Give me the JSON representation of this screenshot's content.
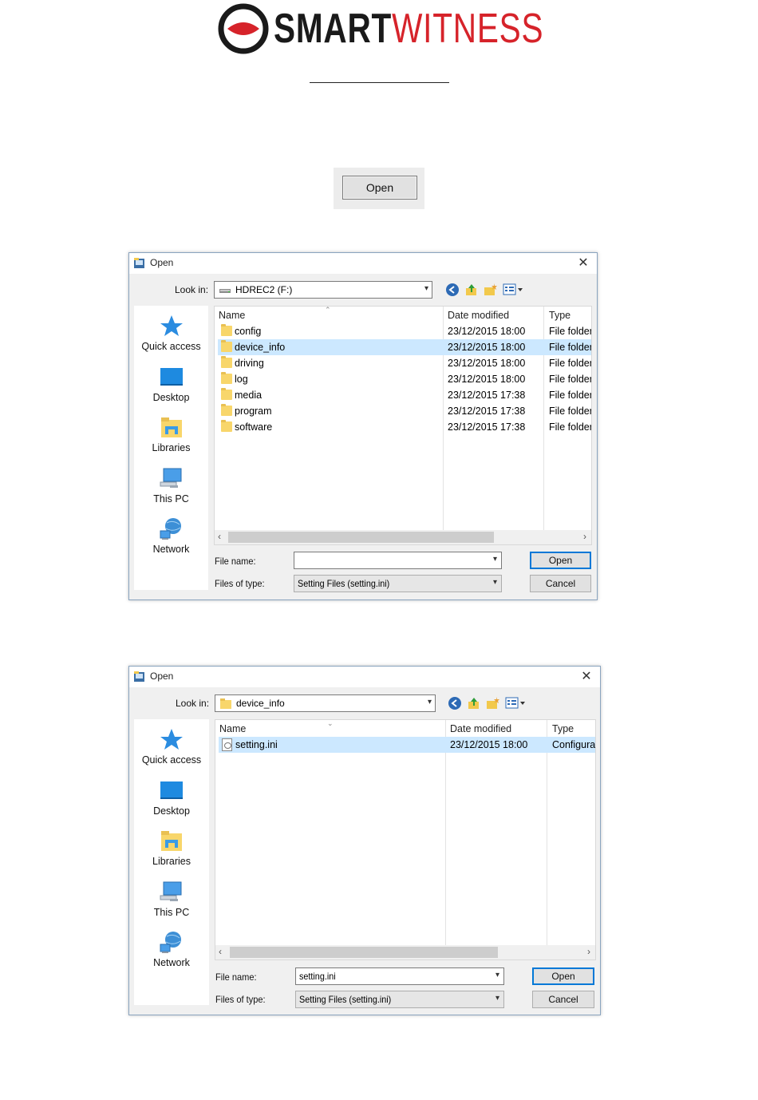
{
  "logo": {
    "smart": "SMART",
    "witness": "WITNESS",
    "brand_red": "#d6232a",
    "brand_dark": "#1a1a1a"
  },
  "open_button": {
    "label": "Open"
  },
  "dialog1": {
    "title": "Open",
    "look_in_label": "Look in:",
    "look_in_value": "HDREC2 (F:)",
    "look_in_icon": "drive-icon",
    "places": [
      {
        "label": "Quick access",
        "icon": "star-icon"
      },
      {
        "label": "Desktop",
        "icon": "desktop-icon"
      },
      {
        "label": "Libraries",
        "icon": "libraries-icon"
      },
      {
        "label": "This PC",
        "icon": "computer-icon"
      },
      {
        "label": "Network",
        "icon": "network-icon"
      }
    ],
    "columns": {
      "name": "Name",
      "date": "Date modified",
      "type": "Type"
    },
    "rows": [
      {
        "name": "config",
        "date": "23/12/2015 18:00",
        "type": "File folder",
        "selected": false
      },
      {
        "name": "device_info",
        "date": "23/12/2015 18:00",
        "type": "File folder",
        "selected": true
      },
      {
        "name": "driving",
        "date": "23/12/2015 18:00",
        "type": "File folder",
        "selected": false
      },
      {
        "name": "log",
        "date": "23/12/2015 18:00",
        "type": "File folder",
        "selected": false
      },
      {
        "name": "media",
        "date": "23/12/2015 17:38",
        "type": "File folder",
        "selected": false
      },
      {
        "name": "program",
        "date": "23/12/2015 17:38",
        "type": "File folder",
        "selected": false
      },
      {
        "name": "software",
        "date": "23/12/2015 17:38",
        "type": "File folder",
        "selected": false
      }
    ],
    "file_name_label": "File name:",
    "file_name_value": "",
    "files_of_type_label": "Files of type:",
    "files_of_type_value": "Setting Files (setting.ini)",
    "open_label": "Open",
    "cancel_label": "Cancel"
  },
  "dialog2": {
    "title": "Open",
    "look_in_label": "Look in:",
    "look_in_value": "device_info",
    "look_in_icon": "folder-icon",
    "places": [
      {
        "label": "Quick access",
        "icon": "star-icon"
      },
      {
        "label": "Desktop",
        "icon": "desktop-icon"
      },
      {
        "label": "Libraries",
        "icon": "libraries-icon"
      },
      {
        "label": "This PC",
        "icon": "computer-icon"
      },
      {
        "label": "Network",
        "icon": "network-icon"
      }
    ],
    "columns": {
      "name": "Name",
      "date": "Date modified",
      "type": "Type"
    },
    "rows": [
      {
        "name": "setting.ini",
        "date": "23/12/2015 18:00",
        "type": "Configura",
        "selected": true
      }
    ],
    "file_name_label": "File name:",
    "file_name_value": "setting.ini",
    "files_of_type_label": "Files of type:",
    "files_of_type_value": "Setting Files (setting.ini)",
    "open_label": "Open",
    "cancel_label": "Cancel"
  },
  "colors": {
    "selection": "#cce8ff",
    "accent": "#0078d7",
    "dialog_bg": "#f0f0f0",
    "border": "#8aa4bf"
  }
}
